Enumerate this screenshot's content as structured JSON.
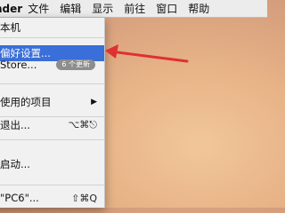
{
  "menubar": {
    "app_name": "nder",
    "items": [
      "文件",
      "编辑",
      "显示",
      "前往",
      "窗口",
      "帮助"
    ]
  },
  "menu": {
    "about": "本机",
    "preferences": "偏好设置...",
    "app_store": "Store...",
    "app_store_badge": "6 个更新",
    "recent_items": "使用的项目",
    "force_quit": "退出...",
    "force_quit_shortcut": "⌥⌘⎋",
    "sleep": "启动...",
    "logout": "\"PC6\"...",
    "logout_shortcut": "⇧⌘Q"
  },
  "colors": {
    "highlight": "#3a6ed8",
    "arrow": "#e03030"
  }
}
